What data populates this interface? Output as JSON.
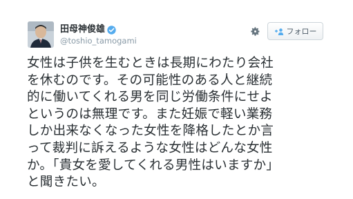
{
  "author": {
    "display_name": "田母神俊雄",
    "screen_name": "@toshio_tamogami",
    "verified": true
  },
  "actions": {
    "follow_label": "フォロー",
    "settings_icon": "gear-icon",
    "follow_icon": "add-user-icon"
  },
  "tweet": {
    "lines": [
      "女性は子供を生むときは長期にわたり会社",
      "を休むのです。その可能性のある人と継続",
      "的に働いてくれる男を同じ労働条件にせよ",
      "というのは無理です。また妊娠で軽い業務",
      "しか出来なくなった女性を降格したとか言",
      "って裁判に訴えるような女性はどんな女性",
      "か。「貴女を愛してくれる男性はいますか」",
      "と聞きたい。"
    ]
  },
  "colors": {
    "text": "#292f33",
    "muted": "#8899a6",
    "verified": "#55acee",
    "button_border": "#cdd5da"
  }
}
